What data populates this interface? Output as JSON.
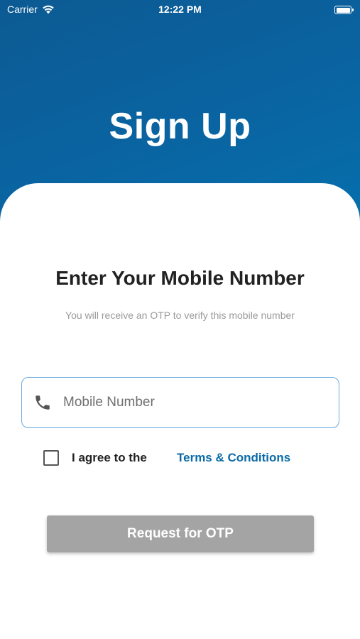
{
  "status_bar": {
    "carrier": "Carrier",
    "time": "12:22 PM"
  },
  "header": {
    "title": "Sign Up"
  },
  "form": {
    "heading": "Enter Your Mobile Number",
    "helper_text": "You will receive an OTP to verify this mobile number",
    "mobile_placeholder": "Mobile Number",
    "mobile_value": "",
    "phone_icon": "phone-icon",
    "agree_label": "I agree to the",
    "terms_link": "Terms & Conditions",
    "agree_checked": false,
    "submit_label": "Request for OTP"
  },
  "colors": {
    "header_gradient_start": "#0c5a93",
    "header_gradient_end": "#0570ad",
    "link": "#0a6aa8",
    "field_border": "#6aa8e0",
    "button_disabled": "#a4a4a4"
  }
}
